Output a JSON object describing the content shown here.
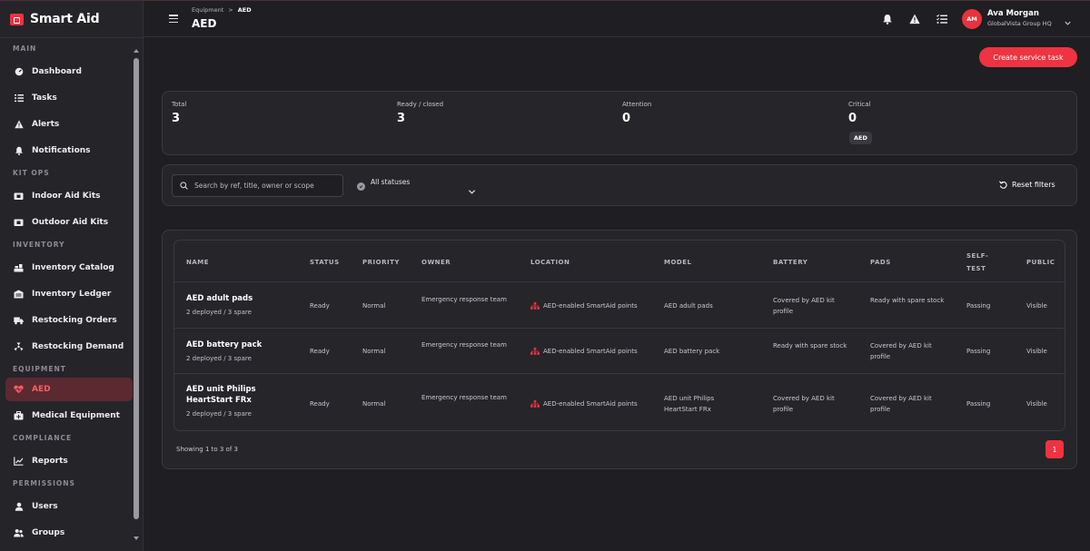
{
  "brand": {
    "name": "Smart Aid"
  },
  "sidebar": {
    "sections": [
      {
        "title": "MAIN",
        "items": [
          {
            "label": "Dashboard",
            "icon": "dashboard-icon"
          },
          {
            "label": "Tasks",
            "icon": "tasks-icon"
          },
          {
            "label": "Alerts",
            "icon": "alert-icon"
          },
          {
            "label": "Notifications",
            "icon": "bell-icon"
          }
        ]
      },
      {
        "title": "KIT OPS",
        "items": [
          {
            "label": "Indoor Aid Kits",
            "icon": "kit-icon"
          },
          {
            "label": "Outdoor Aid Kits",
            "icon": "kit-icon"
          }
        ]
      },
      {
        "title": "INVENTORY",
        "items": [
          {
            "label": "Inventory Catalog",
            "icon": "catalog-icon"
          },
          {
            "label": "Inventory Ledger",
            "icon": "ledger-icon"
          },
          {
            "label": "Restocking Orders",
            "icon": "truck-icon"
          },
          {
            "label": "Restocking Demand",
            "icon": "demand-icon"
          }
        ]
      },
      {
        "title": "EQUIPMENT",
        "items": [
          {
            "label": "AED",
            "icon": "heart-pulse-icon",
            "active": true
          },
          {
            "label": "Medical Equipment",
            "icon": "medical-bag-icon"
          }
        ]
      },
      {
        "title": "COMPLIANCE",
        "items": [
          {
            "label": "Reports",
            "icon": "chart-icon"
          }
        ]
      },
      {
        "title": "PERMISSIONS",
        "items": [
          {
            "label": "Users",
            "icon": "user-icon"
          },
          {
            "label": "Groups",
            "icon": "group-icon"
          }
        ]
      }
    ]
  },
  "header": {
    "breadcrumb_parent": "Equipment",
    "breadcrumb_separator": ">",
    "breadcrumb_current": "AED",
    "title": "AED",
    "user": {
      "initials": "AM",
      "name": "Ava Morgan",
      "org": "GlobalVista Group HQ"
    }
  },
  "actions": {
    "create_label": "Create service task"
  },
  "stats": {
    "total_label": "Total",
    "total_value": "3",
    "ready_label": "Ready / closed",
    "ready_value": "3",
    "attention_label": "Attention",
    "attention_value": "0",
    "critical_label": "Critical",
    "critical_value": "0",
    "critical_chip": "AED"
  },
  "filters": {
    "search_placeholder": "Search by ref, title, owner or scope",
    "status_label": "All statuses",
    "reset_label": "Reset filters"
  },
  "table": {
    "columns": [
      "NAME",
      "STATUS",
      "PRIORITY",
      "OWNER",
      "LOCATION",
      "MODEL",
      "BATTERY",
      "PADS",
      "SELF-",
      "TEST",
      "PUBLIC"
    ],
    "rows": [
      {
        "name": "AED adult pads",
        "sub": "2 deployed / 3 spare",
        "status": "Ready",
        "priority": "Normal",
        "owner": "Emergency response team",
        "location": "AED-enabled SmartAid points",
        "model": "AED adult pads",
        "battery": "Covered by AED kit profile",
        "pads": "Ready with spare stock",
        "selftest": "Passing",
        "public": "Visible"
      },
      {
        "name": "AED battery pack",
        "sub": "2 deployed / 3 spare",
        "status": "Ready",
        "priority": "Normal",
        "owner": "Emergency response team",
        "location": "AED-enabled SmartAid points",
        "model": "AED battery pack",
        "battery": "Ready with spare stock",
        "pads": "Covered by AED kit profile",
        "selftest": "Passing",
        "public": "Visible"
      },
      {
        "name": "AED unit Philips HeartStart FRx",
        "sub": "2 deployed / 3 spare",
        "status": "Ready",
        "priority": "Normal",
        "owner": "Emergency response team",
        "location": "AED-enabled SmartAid points",
        "model": "AED unit Philips HeartStart FRx",
        "battery": "Covered by AED kit profile",
        "pads": "Covered by AED kit profile",
        "selftest": "Passing",
        "public": "Visible"
      }
    ],
    "showing": "Showing 1 to 3 of 3",
    "page": "1"
  },
  "colors": {
    "accent": "#ef3340",
    "background": "#1f1e22",
    "card": "#26252a"
  }
}
